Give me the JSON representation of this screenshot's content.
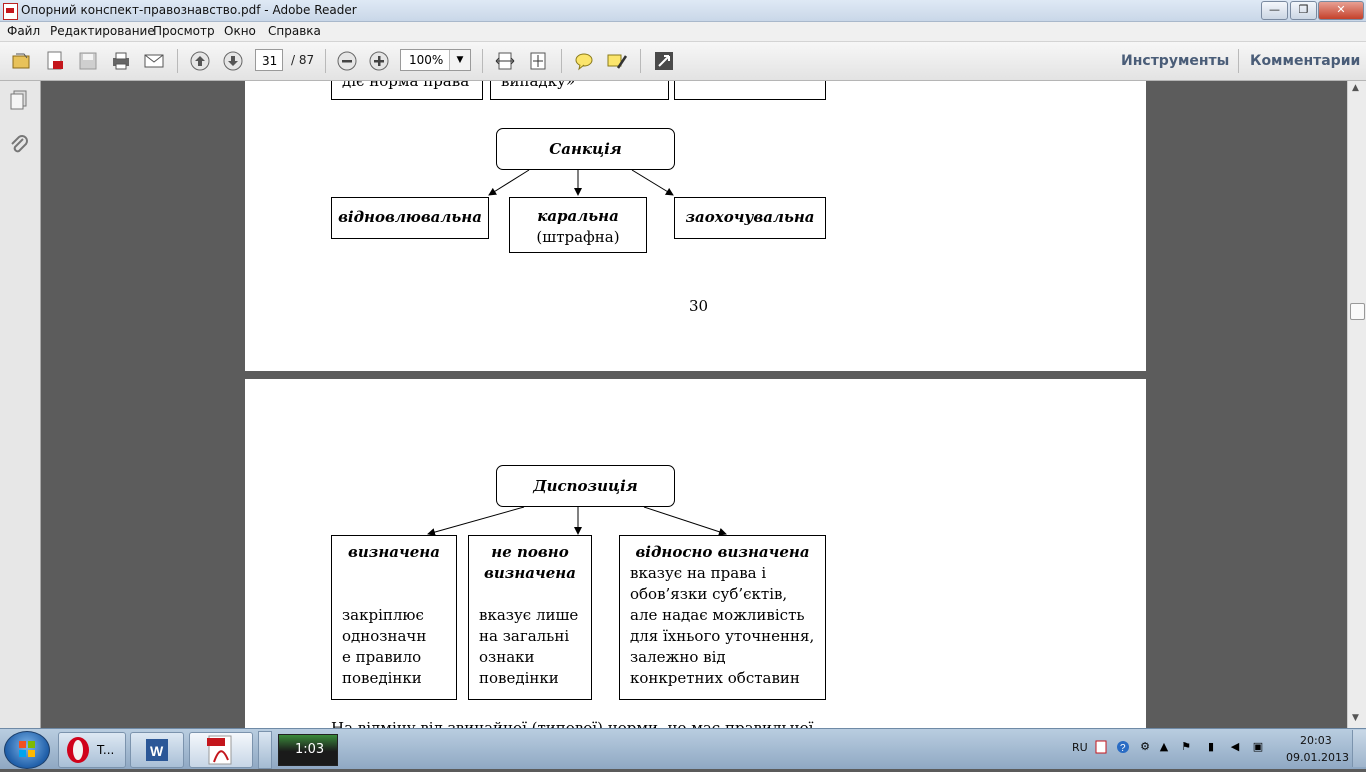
{
  "window": {
    "title": "Опорний конспект-правознавство.pdf - Adobe Reader",
    "minimize": "—",
    "maximize": "❐",
    "close": "✕"
  },
  "menu": [
    "Файл",
    "Редактирование",
    "Просмотр",
    "Окно",
    "Справка"
  ],
  "toolbar": {
    "current_page": "31",
    "total_pages": "/ 87",
    "zoom": "100%",
    "tools_label": "Инструменты",
    "comments_label": "Комментарии"
  },
  "page30": {
    "top_cells": [
      "діє норма права",
      "випадку»",
      ""
    ],
    "title": "Санкція",
    "items": [
      {
        "label": "відновлювальна",
        "sub": ""
      },
      {
        "label": "каральна",
        "sub": "(штрафна)"
      },
      {
        "label": "заохочувальна",
        "sub": ""
      }
    ],
    "page_number": "30"
  },
  "page31": {
    "title": "Диспозиція",
    "items": [
      {
        "label": "визначена",
        "text": [
          "закріплює",
          "однозначн",
          "е правило",
          "поведінки"
        ]
      },
      {
        "label_line1": "не повно",
        "label_line2": "визначена",
        "text": [
          "вказує лише",
          "на загальні",
          "ознаки",
          "поведінки"
        ]
      },
      {
        "label": "відносно визначена",
        "text": [
          "вказує на права і",
          "обов’язки суб’єктів,",
          "але надає можливість",
          "для їхнього уточнення,",
          "залежно від",
          "конкретних обставин"
        ]
      }
    ],
    "footer_text": "На відміну від звичайної (типової) норми, не має правильної"
  },
  "taskbar": {
    "opera_label": "T...",
    "clock_app": "1:03",
    "lang": "RU",
    "time": "20:03",
    "date": "09.01.2013"
  },
  "colors": {
    "accent": "#c4161c",
    "panel_link": "#4a5d78"
  }
}
